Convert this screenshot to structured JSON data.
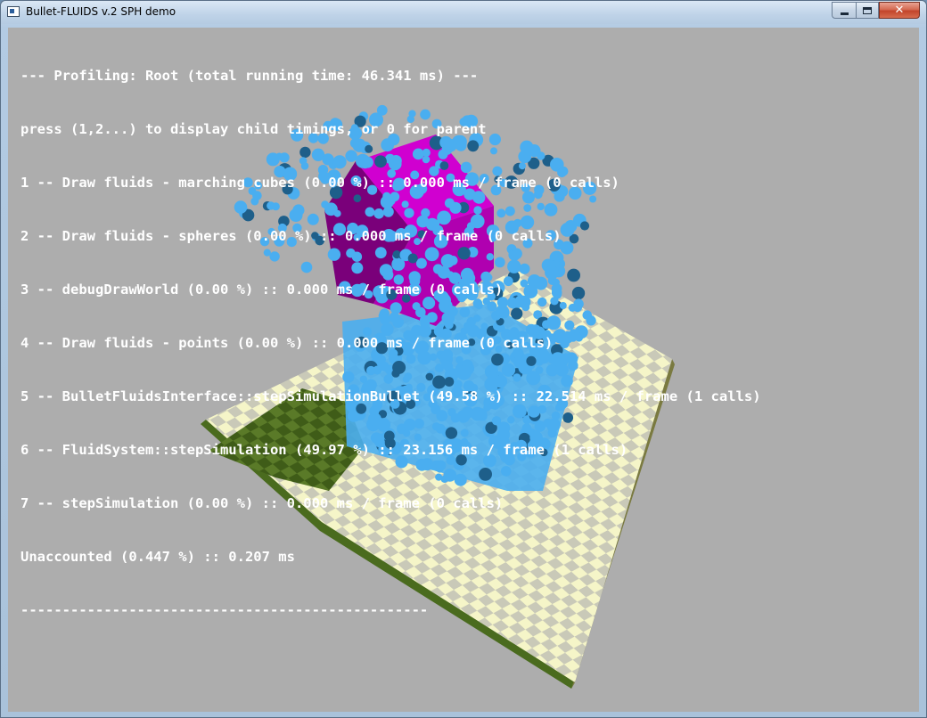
{
  "window": {
    "title": "Bullet-FLUIDS v.2 SPH demo",
    "minimize_label": "",
    "maximize_label": "",
    "close_label": "✕"
  },
  "profile": {
    "lines": [
      "--- Profiling: Root (total running time: 46.341 ms) ---",
      "press (1,2...) to display child timings, or 0 for parent",
      "1 -- Draw fluids - marching cubes (0.00 %) :: 0.000 ms / frame (0 calls)",
      "2 -- Draw fluids - spheres (0.00 %) :: 0.000 ms / frame (0 calls)",
      "3 -- debugDrawWorld (0.00 %) :: 0.000 ms / frame (0 calls)",
      "4 -- Draw fluids - points (0.00 %) :: 0.000 ms / frame (0 calls)",
      "5 -- BulletFluidsInterface::stepSimulationBullet (49.58 %) :: 22.514 ms / frame (1 calls)",
      "6 -- FluidSystem::stepSimulation (49.97 %) :: 23.156 ms / frame (1 calls)",
      "7 -- stepSimulation (0.00 %) :: 0.000 ms / frame (0 calls)",
      "Unaccounted (0.447 %) :: 0.207 ms",
      "-------------------------------------------------"
    ]
  },
  "colors": {
    "background": "#adadad",
    "fluid": "#4aaef0",
    "cube": "#b000b0",
    "checker_light": "#f5f5c8",
    "checker_dark": "#c9c9b8",
    "ground_green": "#4a6b1e"
  }
}
